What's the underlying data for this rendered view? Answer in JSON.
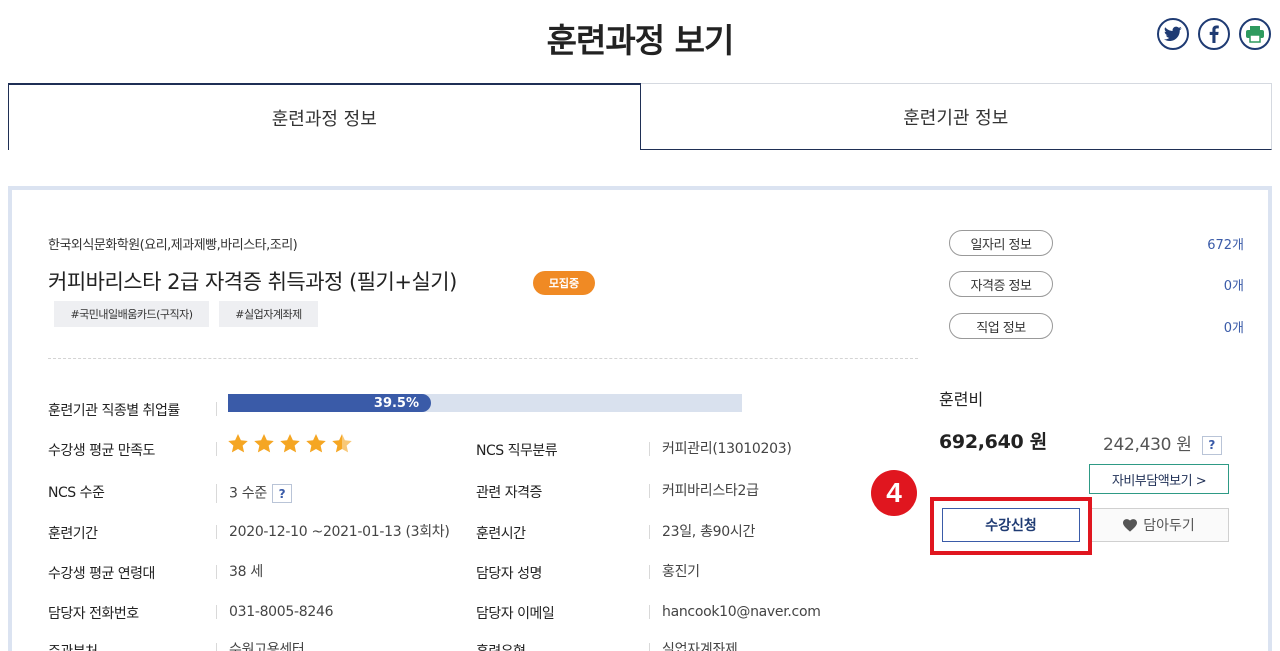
{
  "page": {
    "title": "훈련과정 보기"
  },
  "share": {
    "icons": [
      "twitter-icon",
      "facebook-icon",
      "print-icon"
    ],
    "brand_color": "#1f3b73"
  },
  "tabs": [
    {
      "label": "훈련과정 정보",
      "active": true
    },
    {
      "label": "훈련기관 정보",
      "active": false
    }
  ],
  "course": {
    "institution": "한국외식문화학원(요리,제과제빵,바리스타,조리)",
    "title": "커피바리스타 2급 자격증 취득과정 (필기+실기)",
    "status_badge": "모집중",
    "tags": [
      "#국민내일배움카드(구직자)",
      "#실업자계좌제"
    ]
  },
  "details": {
    "employment_rate": {
      "label": "훈련기관 직종별 취업률",
      "value": "39.5%",
      "percent": 39.5
    },
    "satisfaction": {
      "label": "수강생 평균 만족도",
      "stars": 4.5,
      "star_color": "#f5a623"
    },
    "ncs_class": {
      "label": "NCS 직무분류",
      "value": "커피관리(13010203)"
    },
    "ncs_level": {
      "label": "NCS 수준",
      "value": "3 수준",
      "help": "?"
    },
    "related_cert": {
      "label": "관련 자격증",
      "value": "커피바리스타2급"
    },
    "period": {
      "label": "훈련기간",
      "value": "2020-12-10 ~2021-01-13 (3회차)"
    },
    "hours": {
      "label": "훈련시간",
      "value": "23일, 총90시간"
    },
    "avg_age": {
      "label": "수강생 평균 연령대",
      "value": "38 세"
    },
    "contact_name": {
      "label": "담당자 성명",
      "value": "홍진기"
    },
    "phone": {
      "label": "담당자 전화번호",
      "value": "031-8005-8246"
    },
    "email": {
      "label": "담당자 이메일",
      "value": "hancook10@naver.com"
    },
    "office": {
      "label": "주관부처",
      "value": "수원고용센터"
    },
    "type": {
      "label": "훈련유형",
      "value": "실업자계좌제"
    }
  },
  "side": {
    "links": [
      {
        "label": "일자리 정보",
        "count": "672개"
      },
      {
        "label": "자격증 정보",
        "count": "0개"
      },
      {
        "label": "직업 정보",
        "count": "0개"
      }
    ],
    "fee_label": "훈련비",
    "fee_total": "692,640 원",
    "fee_self": "242,430 원",
    "fee_help": "?",
    "selfpay_button": "자비부담액보기 >",
    "apply_button": "수강신청",
    "wish_button": "담아두기"
  },
  "annotation": {
    "step_number": "4",
    "color": "#e0161f"
  }
}
